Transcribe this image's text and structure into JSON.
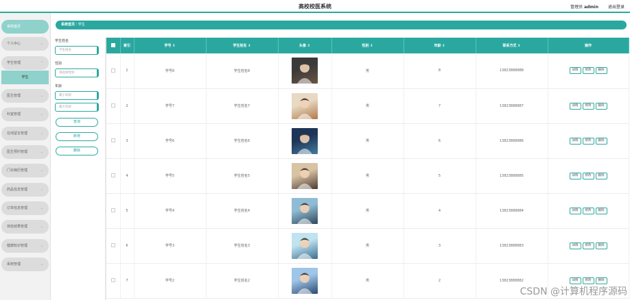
{
  "header": {
    "app_title": "高校校医系统",
    "user_prefix": "管理员",
    "username": "admin",
    "logout_label": "退出登录"
  },
  "sidebar": {
    "home": "系统首页",
    "items": [
      {
        "label": "个人中心"
      },
      {
        "label": "学生管理"
      },
      {
        "label": "医生管理"
      },
      {
        "label": "科室管理"
      },
      {
        "label": "在线留言管理"
      },
      {
        "label": "医生预约管理"
      },
      {
        "label": "门诊病历管理"
      },
      {
        "label": "药品信息管理"
      },
      {
        "label": "订单信息管理"
      },
      {
        "label": "体检结果管理"
      },
      {
        "label": "健康知识管理"
      },
      {
        "label": "系统管理"
      }
    ],
    "sub_active": "学生"
  },
  "breadcrumb": {
    "home": "系统首页",
    "separator": "⁝",
    "current": "学生"
  },
  "filters": {
    "name_label": "学生姓名",
    "name_placeholder": "学生姓名",
    "gender_label": "性别",
    "gender_placeholder": "请选择性别",
    "age_label": "年龄",
    "min_age_placeholder": "最小年龄",
    "max_age_placeholder": "最大年龄",
    "search_button": "查询",
    "add_button": "新增",
    "delete_button": "删除"
  },
  "table": {
    "columns": [
      "索引",
      "学号 ⇕",
      "学生姓名 ⇕",
      "头像 ⇕",
      "性别 ⇕",
      "年龄 ⇕",
      "联系方式 ⇕",
      "操作"
    ],
    "rows": [
      {
        "index": "1",
        "id": "学号8",
        "name": "学生姓名8",
        "gender": "男",
        "age": "8",
        "phone": "13823888888"
      },
      {
        "index": "2",
        "id": "学号7",
        "name": "学生姓名7",
        "gender": "男",
        "age": "7",
        "phone": "13823888887"
      },
      {
        "index": "3",
        "id": "学号6",
        "name": "学生姓名6",
        "gender": "男",
        "age": "6",
        "phone": "13823888886"
      },
      {
        "index": "4",
        "id": "学号5",
        "name": "学生姓名5",
        "gender": "男",
        "age": "5",
        "phone": "13823888885"
      },
      {
        "index": "5",
        "id": "学号4",
        "name": "学生姓名4",
        "gender": "男",
        "age": "4",
        "phone": "13823888884"
      },
      {
        "index": "6",
        "id": "学号3",
        "name": "学生姓名3",
        "gender": "男",
        "age": "3",
        "phone": "13823888883"
      },
      {
        "index": "7",
        "id": "学号2",
        "name": "学生姓名2",
        "gender": "男",
        "age": "2",
        "phone": "13823888882"
      }
    ],
    "actions": {
      "detail": "详情",
      "edit": "修改",
      "delete": "删除"
    }
  },
  "watermark": "CSDN @计算机程序源码",
  "colors": {
    "accent": "#2aa8a0",
    "sidebar_active": "#8fd2cc"
  }
}
